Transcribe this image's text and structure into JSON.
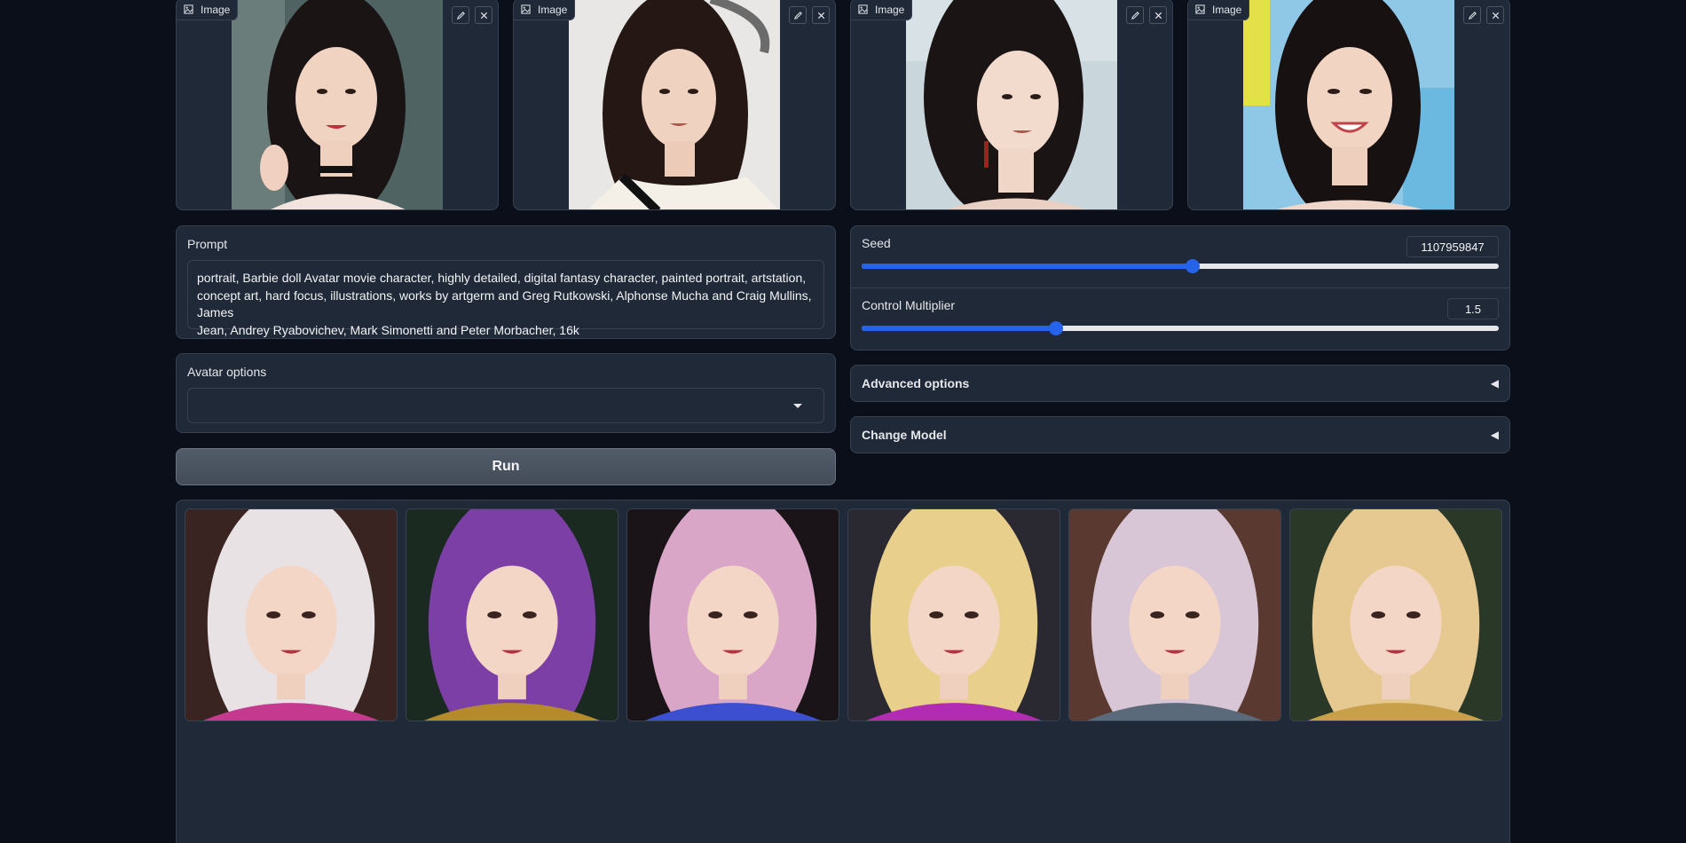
{
  "inputs": {
    "images": [
      {
        "label": "Image",
        "id_hint": "ref-1"
      },
      {
        "label": "Image",
        "id_hint": "ref-2"
      },
      {
        "label": "Image",
        "id_hint": "ref-3"
      },
      {
        "label": "Image",
        "id_hint": "ref-4"
      }
    ]
  },
  "prompt": {
    "label": "Prompt",
    "value": "portrait, Barbie doll Avatar movie character, highly detailed, digital fantasy character, painted portrait, artstation,\nconcept art, hard focus, illustrations, works by artgerm and Greg Rutkowski, Alphonse Mucha and Craig Mullins, James\nJean, Andrey Ryabovichev, Mark Simonetti and Peter Morbacher, 16k"
  },
  "avatar_options": {
    "label": "Avatar options",
    "selected": ""
  },
  "run": {
    "label": "Run"
  },
  "seed": {
    "label": "Seed",
    "value": "1107959847",
    "fraction": 0.52
  },
  "control_multiplier": {
    "label": "Control Multiplier",
    "value": "1.5",
    "fraction": 0.305
  },
  "advanced_options": {
    "label": "Advanced options",
    "arrow": "◀"
  },
  "change_model": {
    "label": "Change Model",
    "arrow": "◀"
  },
  "gallery": {
    "count": 6,
    "hair_colors": [
      "#e8e2e4",
      "#7b3fa6",
      "#d9a6c8",
      "#e9cf8c",
      "#d8c6d6",
      "#e6c891"
    ]
  },
  "icons": {
    "image": "image-icon",
    "edit": "pencil-icon",
    "close": "close-icon",
    "dropdown": "chevron-down-icon"
  },
  "colors": {
    "background": "#0b0f19",
    "panel": "#1f2937",
    "accent": "#2563eb"
  }
}
